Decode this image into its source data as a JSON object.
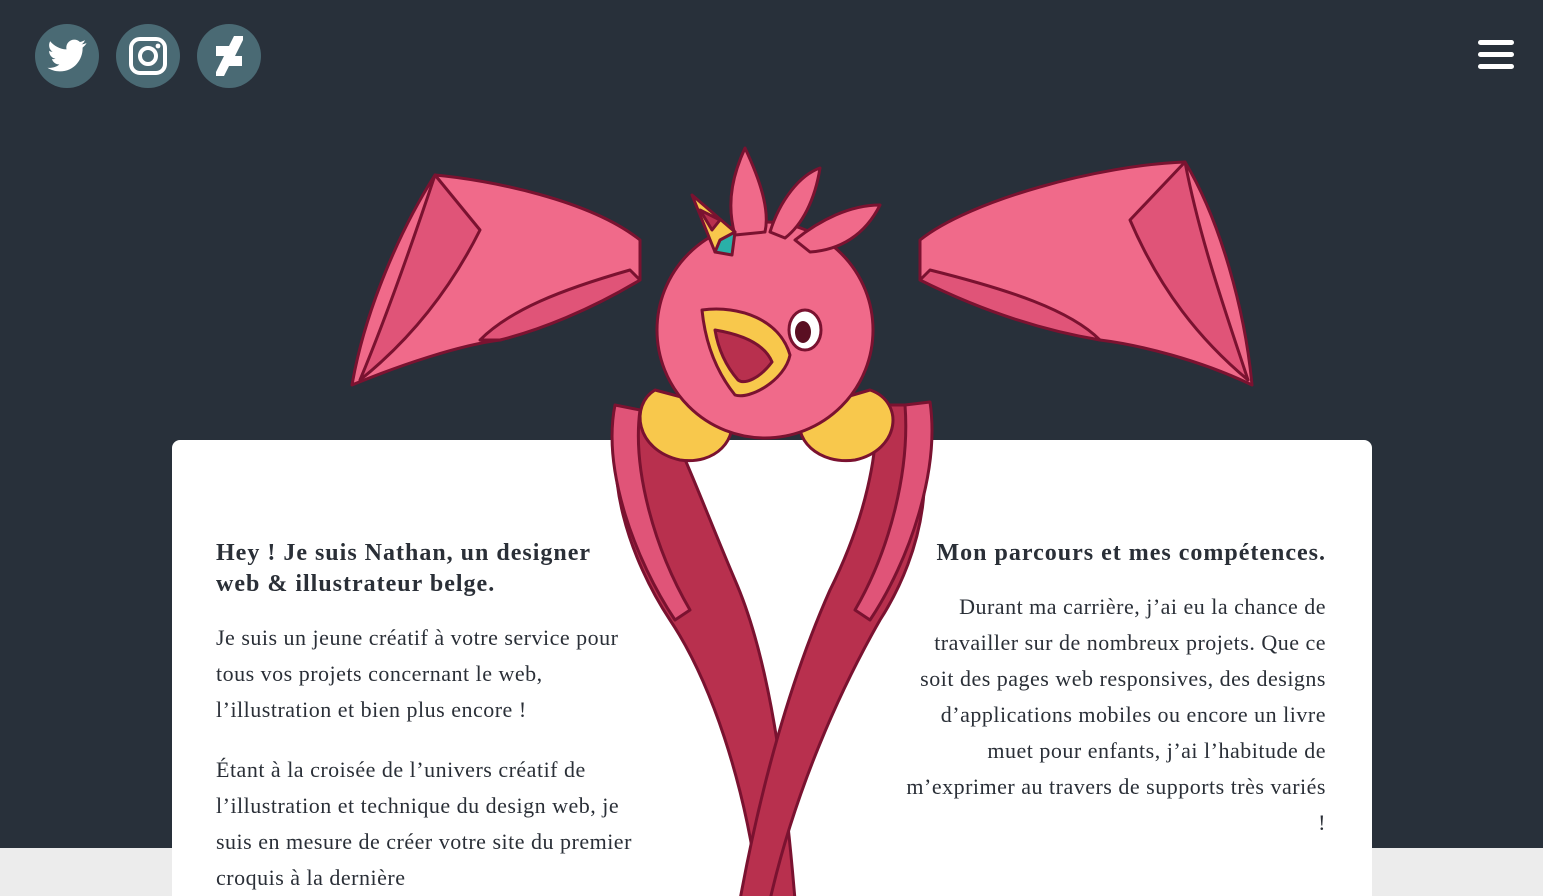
{
  "colors": {
    "hero_background": "#28303a",
    "social_button": "#4a6a74",
    "card": "#ffffff",
    "mascot_pink": "#f06a8a",
    "mascot_dark": "#b8304e",
    "beak_yellow": "#f8c84c"
  },
  "header": {
    "social_icons": [
      "twitter-icon",
      "instagram-icon",
      "deviantart-icon"
    ],
    "menu_icon": "hamburger-menu-icon"
  },
  "about": {
    "heading": "Hey ! Je suis Nathan, un designer web & illustrateur belge.",
    "paragraphs": [
      "Je suis un jeune créatif à votre service pour tous vos projets concernant le web, l’illustration et bien plus encore !",
      "Étant à la croisée de l’univers créatif de l’illustration et technique du design web, je suis en mesure de créer votre site du premier croquis à la dernière"
    ]
  },
  "career": {
    "heading": "Mon parcours et mes compétences.",
    "paragraphs": [
      "Durant ma carrière, j’ai eu la chance de travailler sur de nombreux projets. Que ce soit des pages web responsives, des designs d’applications mobiles ou encore un livre muet pour enfants, j’ai l’habitude de m’exprimer au travers de supports très variés !"
    ]
  }
}
